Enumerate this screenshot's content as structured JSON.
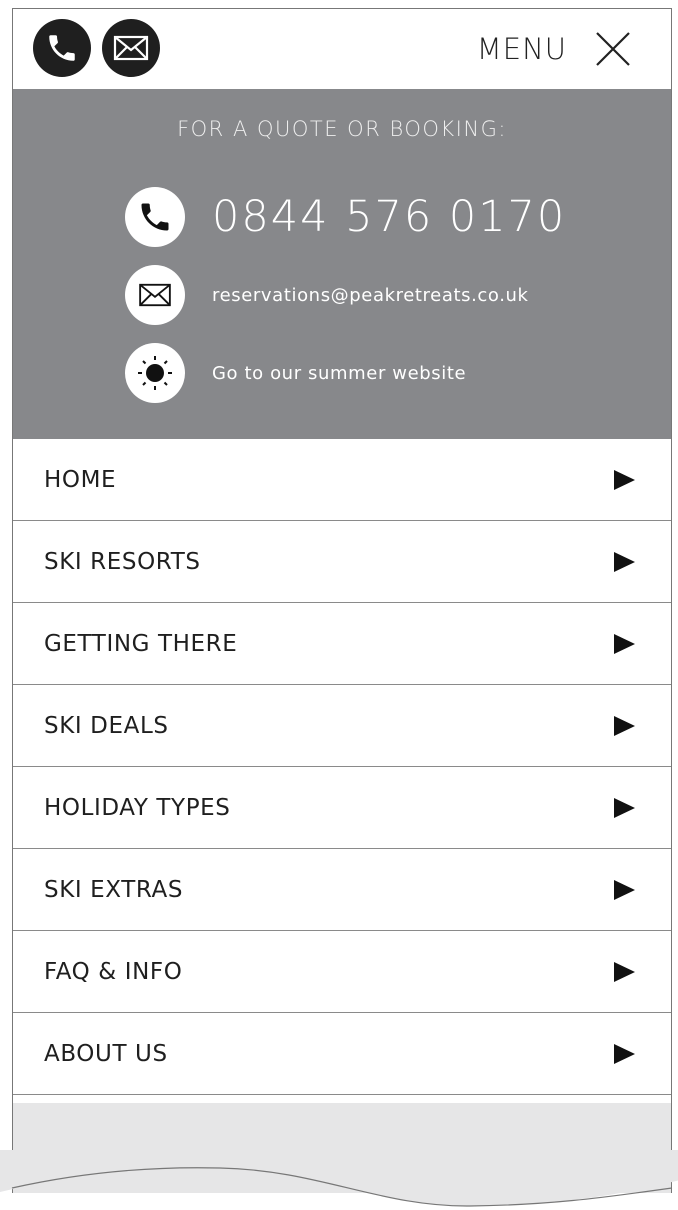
{
  "header": {
    "menu_label": "MENU",
    "icons": [
      "phone-icon",
      "mail-icon",
      "close-icon"
    ]
  },
  "contact": {
    "heading": "FOR A QUOTE OR BOOKING:",
    "phone": "0844 576 0170",
    "email": "reservations@peakretreats.co.uk",
    "summer_link": "Go to our summer website",
    "icons": [
      "phone-icon",
      "mail-icon",
      "sun-icon"
    ]
  },
  "nav": {
    "items": [
      {
        "label": "HOME"
      },
      {
        "label": "SKI RESORTS"
      },
      {
        "label": "GETTING THERE"
      },
      {
        "label": "SKI DEALS"
      },
      {
        "label": "HOLIDAY TYPES"
      },
      {
        "label": "SKI EXTRAS"
      },
      {
        "label": "FAQ & INFO"
      },
      {
        "label": "ABOUT US"
      }
    ]
  },
  "colors": {
    "panel_bg": "#87888b",
    "icon_dark": "#1f1f1f",
    "footer_bg": "#e6e6e7"
  }
}
